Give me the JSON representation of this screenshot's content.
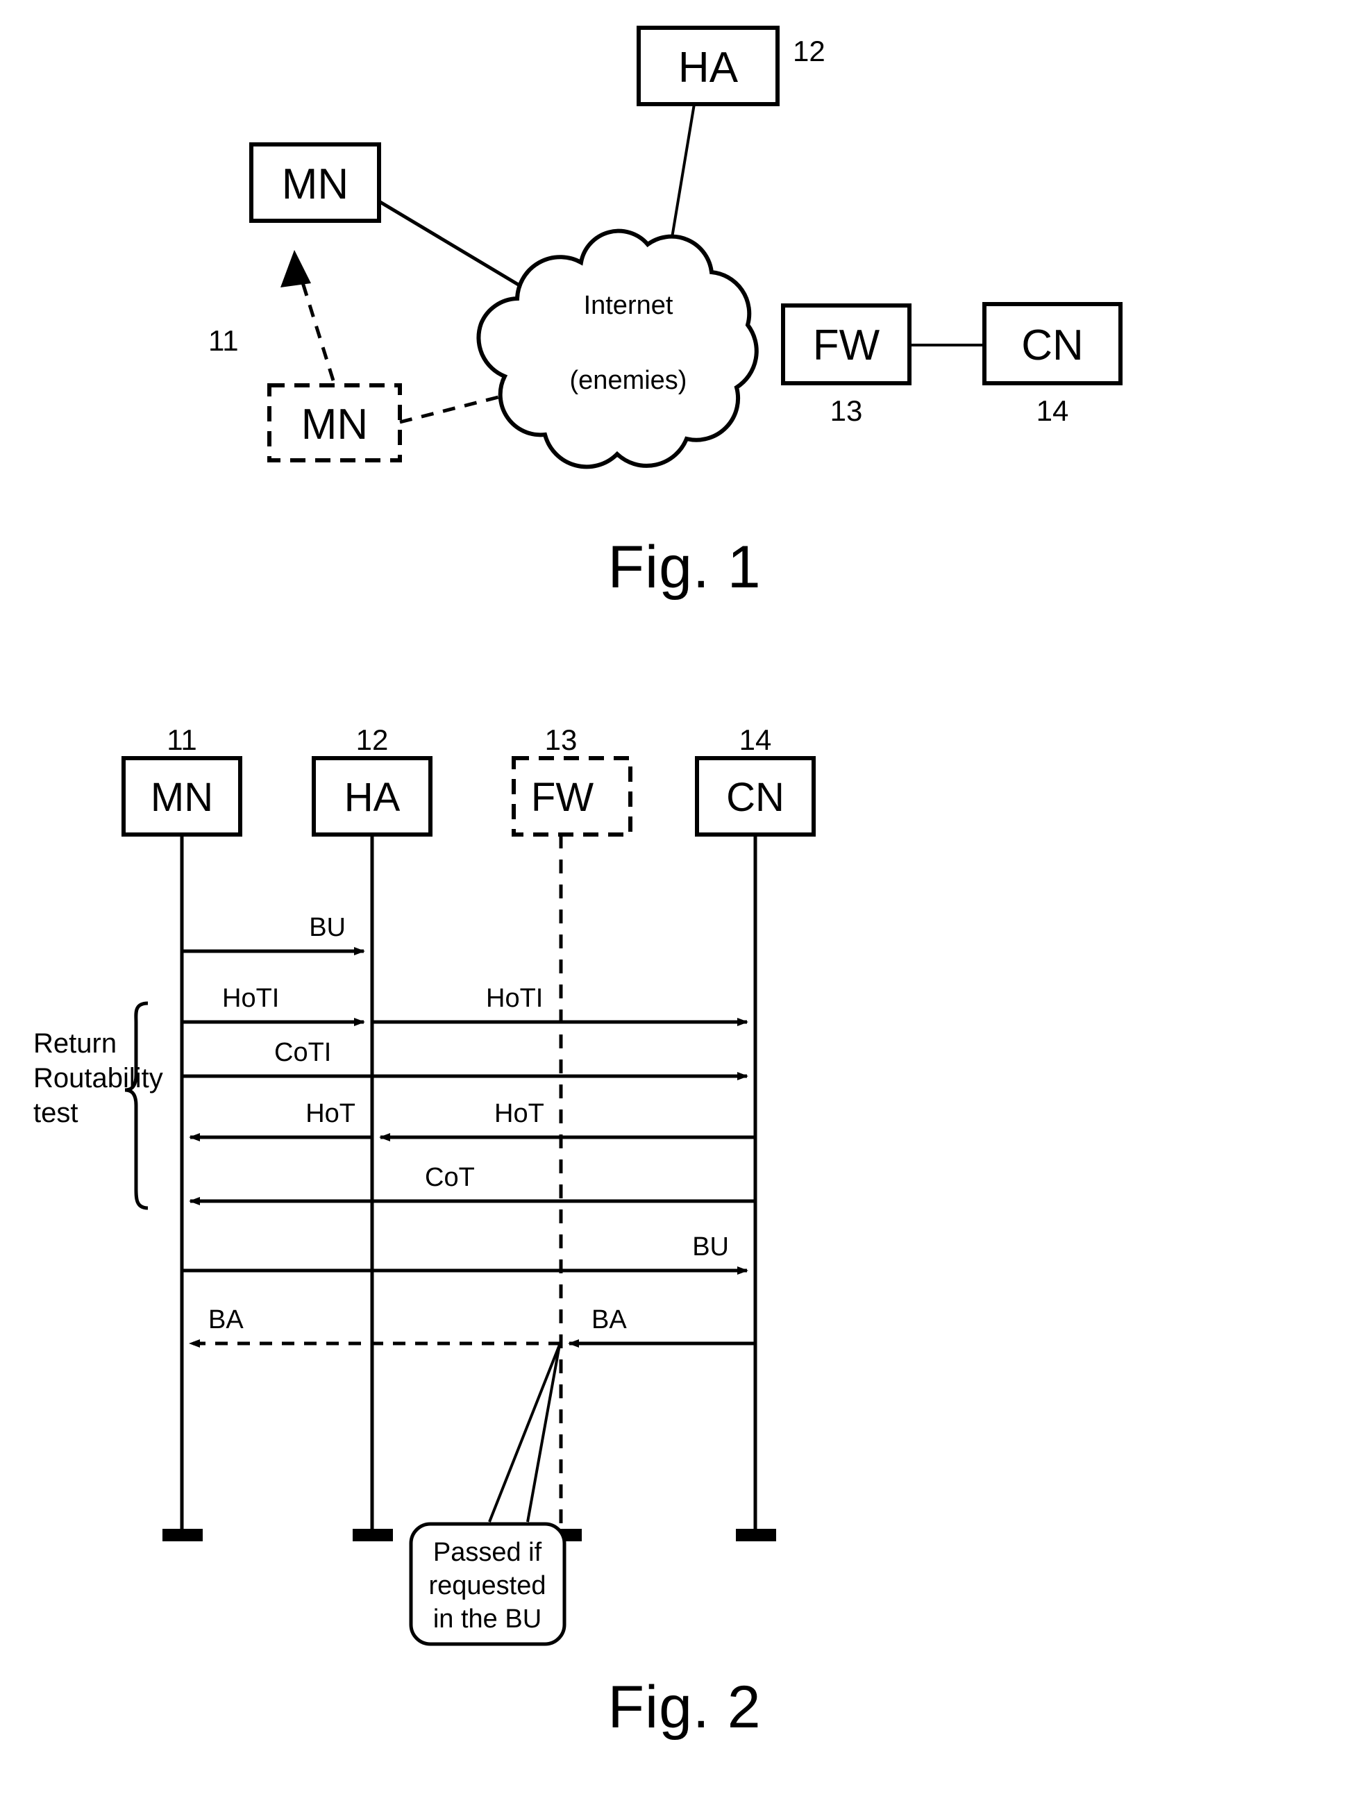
{
  "figures": [
    {
      "caption": "Fig. 1",
      "nodes": {
        "mn_new": "MN",
        "mn_old": "MN",
        "ha": "HA",
        "fw": "FW",
        "cn": "CN"
      },
      "cloud": {
        "line1": "Internet",
        "line2": "(enemies)"
      },
      "refs": {
        "mn": "11",
        "ha": "12",
        "fw": "13",
        "cn": "14"
      }
    },
    {
      "caption": "Fig. 2",
      "lifelines": [
        {
          "label": "MN",
          "ref": "11",
          "dashed_box": false
        },
        {
          "label": "HA",
          "ref": "12",
          "dashed_box": false
        },
        {
          "label": "FW",
          "ref": "13",
          "dashed_box": true
        },
        {
          "label": "CN",
          "ref": "14",
          "dashed_box": false
        }
      ],
      "messages": [
        {
          "label": "BU",
          "from": "MN",
          "to": "HA",
          "direction": "right",
          "style": "solid"
        },
        {
          "label": "HoTI",
          "from": "MN",
          "to": "HA",
          "direction": "right",
          "style": "solid"
        },
        {
          "label": "HoTI",
          "from": "HA",
          "to": "CN",
          "direction": "right",
          "style": "solid"
        },
        {
          "label": "CoTI",
          "from": "MN",
          "to": "CN",
          "direction": "right",
          "style": "solid"
        },
        {
          "label": "HoT",
          "from": "HA",
          "to": "MN",
          "direction": "left",
          "style": "solid"
        },
        {
          "label": "HoT",
          "from": "CN",
          "to": "HA",
          "direction": "left",
          "style": "solid"
        },
        {
          "label": "CoT",
          "from": "CN",
          "to": "MN",
          "direction": "left",
          "style": "solid"
        },
        {
          "label": "BU",
          "from": "MN",
          "to": "CN",
          "direction": "right",
          "style": "solid"
        },
        {
          "label": "BA",
          "from": "FW",
          "to": "MN",
          "direction": "left",
          "style": "dashed"
        },
        {
          "label": "BA",
          "from": "CN",
          "to": "FW",
          "direction": "left",
          "style": "solid"
        }
      ],
      "brace_label": {
        "line1": "Return",
        "line2": "Routability",
        "line3": "test"
      },
      "callout": {
        "line1": "Passed if",
        "line2": "requested",
        "line3": "in the BU"
      }
    }
  ],
  "colors": {
    "ink": "#000000",
    "paper": "#ffffff"
  }
}
